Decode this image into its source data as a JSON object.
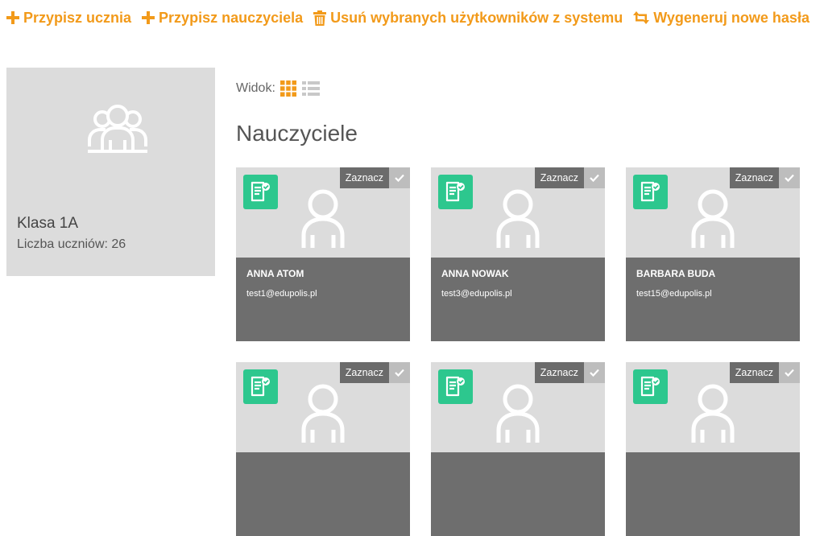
{
  "toolbar": {
    "assign_student": "Przypisz ucznia",
    "assign_teacher": "Przypisz nauczyciela",
    "delete_selected": "Usuń wybranych użytkowników z systemu",
    "regenerate_passwords": "Wygeneruj nowe hasła"
  },
  "class_info": {
    "name": "Klasa 1A",
    "student_count": "Liczba uczniów: 26"
  },
  "view": {
    "label": "Widok:",
    "active_mode": "grid",
    "active_color": "#f29a1a",
    "inactive_color": "#c8c8c8"
  },
  "section": {
    "title": "Nauczyciele"
  },
  "colors": {
    "accent": "#f29a1a",
    "badge": "#2dc78e",
    "card_bg": "#dcdcdc",
    "card_info_bg": "#6e6e6e"
  },
  "teachers": [
    {
      "name": "ANNA ATOM",
      "email": "test1@edupolis.pl",
      "select_label": "Zaznacz"
    },
    {
      "name": "ANNA NOWAK",
      "email": "test3@edupolis.pl",
      "select_label": "Zaznacz"
    },
    {
      "name": "BARBARA BUDA",
      "email": "test15@edupolis.pl",
      "select_label": "Zaznacz"
    },
    {
      "name": "",
      "email": "",
      "select_label": "Zaznacz"
    },
    {
      "name": "",
      "email": "",
      "select_label": "Zaznacz"
    },
    {
      "name": "",
      "email": "",
      "select_label": "Zaznacz"
    }
  ]
}
